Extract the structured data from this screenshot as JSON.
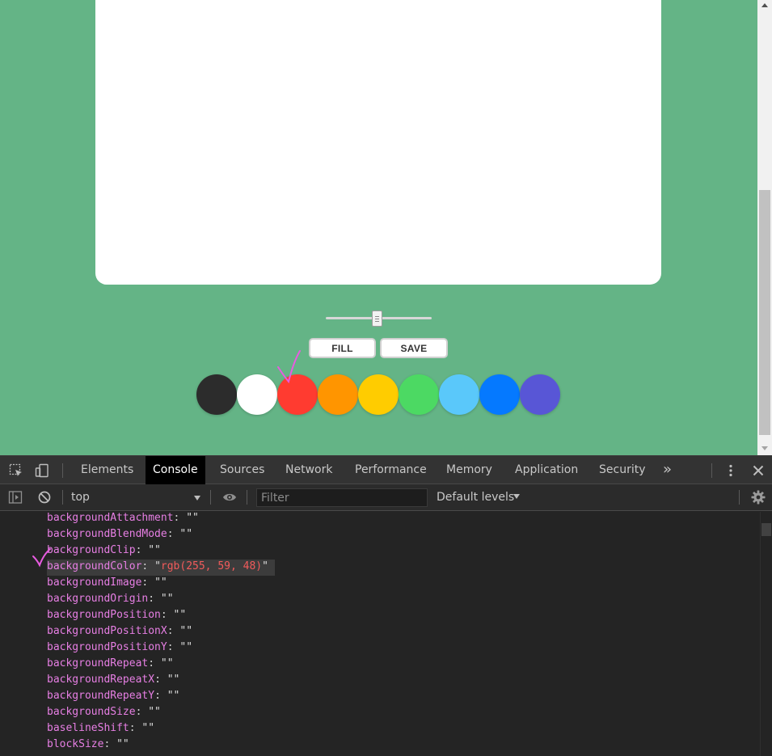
{
  "page": {
    "buttons": {
      "fill_label": "FILL",
      "save_label": "SAVE"
    },
    "range": {
      "value_fraction": 0.48
    },
    "palette": [
      {
        "name": "black",
        "color": "#2c2c2c"
      },
      {
        "name": "white",
        "color": "#ffffff"
      },
      {
        "name": "red",
        "color": "#ff3b30"
      },
      {
        "name": "orange",
        "color": "#ff9500"
      },
      {
        "name": "yellow",
        "color": "#ffcc00"
      },
      {
        "name": "green",
        "color": "#4cd963"
      },
      {
        "name": "sky-blue",
        "color": "#5ac8fa"
      },
      {
        "name": "blue",
        "color": "#0579ff"
      },
      {
        "name": "purple",
        "color": "#5856d6"
      }
    ],
    "background_color": "#64b486"
  },
  "devtools": {
    "tabs": [
      {
        "id": "elements",
        "label": "Elements",
        "active": false
      },
      {
        "id": "console",
        "label": "Console",
        "active": true
      },
      {
        "id": "sources",
        "label": "Sources",
        "active": false
      },
      {
        "id": "network",
        "label": "Network",
        "active": false
      },
      {
        "id": "performance",
        "label": "Performance",
        "active": false
      },
      {
        "id": "memory",
        "label": "Memory",
        "active": false
      },
      {
        "id": "application",
        "label": "Application",
        "active": false
      },
      {
        "id": "security",
        "label": "Security",
        "active": false
      }
    ],
    "more_tabs_glyph": "»",
    "context": "top",
    "filter_placeholder": "Filter",
    "levels_label": "Default levels",
    "properties": [
      {
        "key": "backgroundAttachment",
        "value": "\"\""
      },
      {
        "key": "backgroundBlendMode",
        "value": "\"\""
      },
      {
        "key": "backgroundClip",
        "value": "\"\""
      },
      {
        "key": "backgroundColor",
        "value": "rgb(255, 59, 48)",
        "highlighted": true
      },
      {
        "key": "backgroundImage",
        "value": "\"\""
      },
      {
        "key": "backgroundOrigin",
        "value": "\"\""
      },
      {
        "key": "backgroundPosition",
        "value": "\"\""
      },
      {
        "key": "backgroundPositionX",
        "value": "\"\""
      },
      {
        "key": "backgroundPositionY",
        "value": "\"\""
      },
      {
        "key": "backgroundRepeat",
        "value": "\"\""
      },
      {
        "key": "backgroundRepeatX",
        "value": "\"\""
      },
      {
        "key": "backgroundRepeatY",
        "value": "\"\""
      },
      {
        "key": "backgroundSize",
        "value": "\"\""
      },
      {
        "key": "baselineShift",
        "value": "\"\""
      },
      {
        "key": "blockSize",
        "value": "\"\""
      }
    ]
  },
  "colors": {
    "accent_annotation": "#e85be0",
    "string_value": "#f25b5b",
    "property_key": "#e77fe4"
  }
}
